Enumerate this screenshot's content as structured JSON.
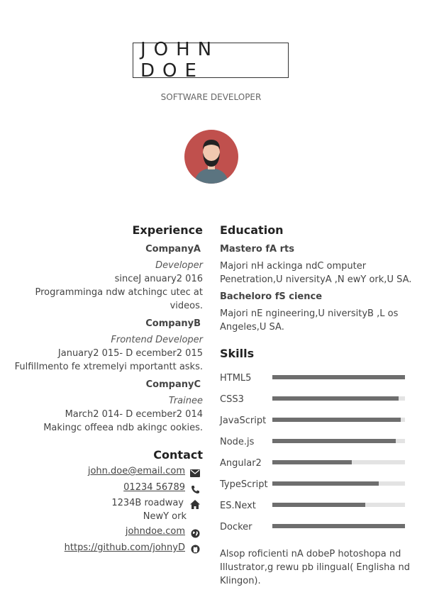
{
  "header": {
    "name": "JOHN DOE",
    "title": "SOFTWARE DEVELOPER"
  },
  "experience": {
    "heading": "Experience",
    "jobs": [
      {
        "company": "CompanyA",
        "role": "Developer",
        "dates": "sinceJ anuary2 016",
        "desc1": "Programminga ndw atchingc utec at",
        "desc2": "videos."
      },
      {
        "company": "CompanyB",
        "role": "Frontend Developer",
        "dates": "January2 015- D ecember2 015",
        "desc1": "Fulfillmento fe xtremelyi mportantt asks."
      },
      {
        "company": "CompanyC",
        "role": "Trainee",
        "dates": "March2 014- D ecember2 014",
        "desc1": "Makingc offeea ndb akingc ookies."
      }
    ]
  },
  "contact": {
    "heading": "Contact",
    "email": "john.doe@email.com",
    "phone": "01234 56789",
    "address1": "1234B roadway",
    "address2": "NewY ork",
    "website": "johndoe.com",
    "github": "https://github.com/johnyD",
    "icons": [
      "envelope-icon",
      "phone-icon",
      "home-icon",
      "globe-icon",
      "github-icon"
    ]
  },
  "education": {
    "heading": "Education",
    "degrees": [
      {
        "title": "Mastero fA rts",
        "line1": "Majori nH ackinga ndC omputer",
        "line2": "Penetration,U niversityA ,N ewY ork,U SA."
      },
      {
        "title": "Bacheloro fS cience",
        "line1": "Majori nE ngineering,U niversityB ,L os",
        "line2": "Angeles,U SA."
      }
    ]
  },
  "skills": {
    "heading": "Skills",
    "items": [
      {
        "name": "HTML5",
        "level": 1.0
      },
      {
        "name": "CSS3",
        "level": 0.95
      },
      {
        "name": "JavaScript",
        "level": 0.97
      },
      {
        "name": "Node.js",
        "level": 0.93
      },
      {
        "name": "Angular2",
        "level": 0.6
      },
      {
        "name": "TypeScript",
        "level": 0.8
      },
      {
        "name": "ES.Next",
        "level": 0.7
      },
      {
        "name": "Docker",
        "level": 1.0
      }
    ],
    "note1": "Alsop roficienti nA dobeP hotoshopa nd",
    "note2": "Illustrator,g rewu pb ilingual( Englisha nd",
    "note3": "Klingon)."
  },
  "colors": {
    "avatar_bg": "#c0504d",
    "bar_fill": "#6e6e6e",
    "bar_bg": "#e3e3e3"
  }
}
